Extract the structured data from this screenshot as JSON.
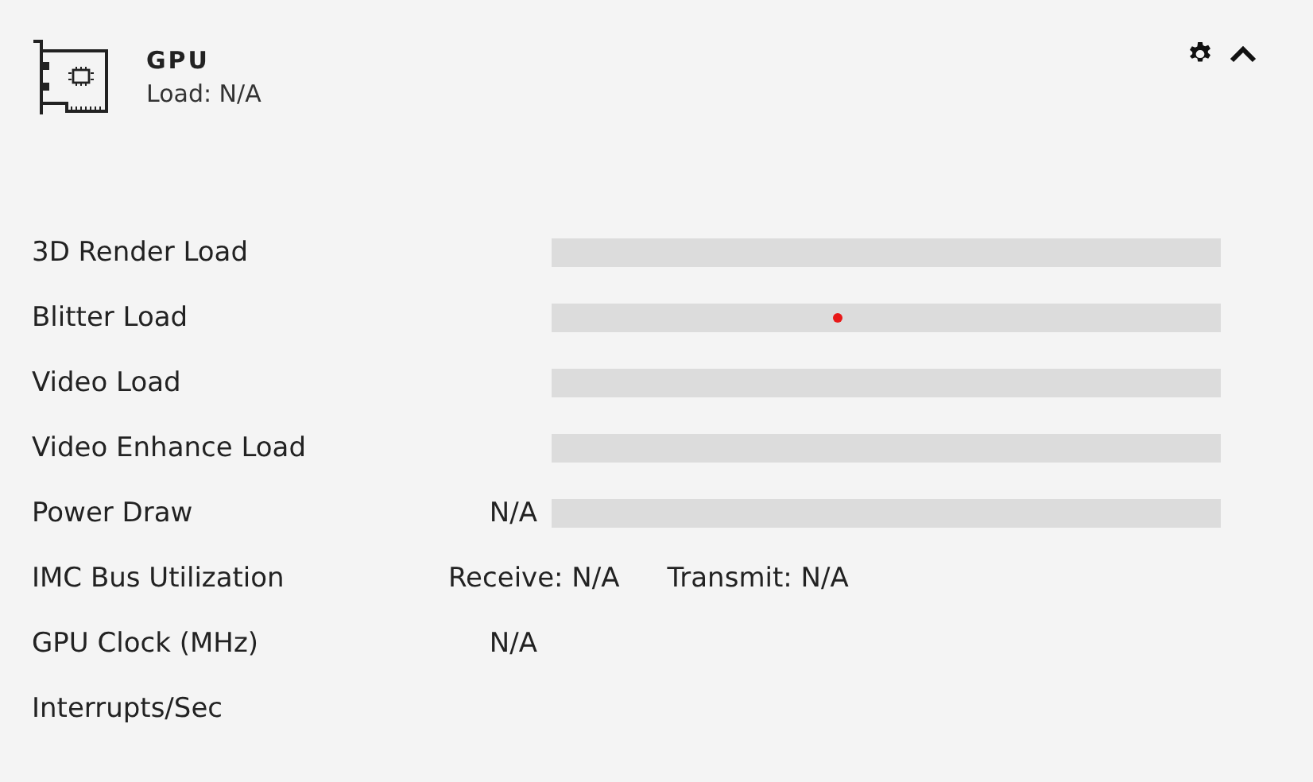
{
  "header": {
    "title": "GPU",
    "subtitle": "Load: N/A"
  },
  "rows": [
    {
      "kind": "bar",
      "label": "3D Render Load",
      "level": 0
    },
    {
      "kind": "bar",
      "label": "Blitter Load",
      "level": 0
    },
    {
      "kind": "bar",
      "label": "Video Load",
      "level": 0
    },
    {
      "kind": "bar",
      "label": "Video Enhance Load",
      "level": 0
    },
    {
      "kind": "bar",
      "label": "Power Draw",
      "value": "N/A",
      "level": 0
    },
    {
      "kind": "pair",
      "label": "IMC Bus Utilization",
      "receive": "Receive: N/A",
      "transmit": "Transmit: N/A"
    },
    {
      "kind": "text",
      "label": "GPU Clock (MHz)",
      "value": "N/A"
    },
    {
      "kind": "text",
      "label": "Interrupts/Sec"
    }
  ]
}
